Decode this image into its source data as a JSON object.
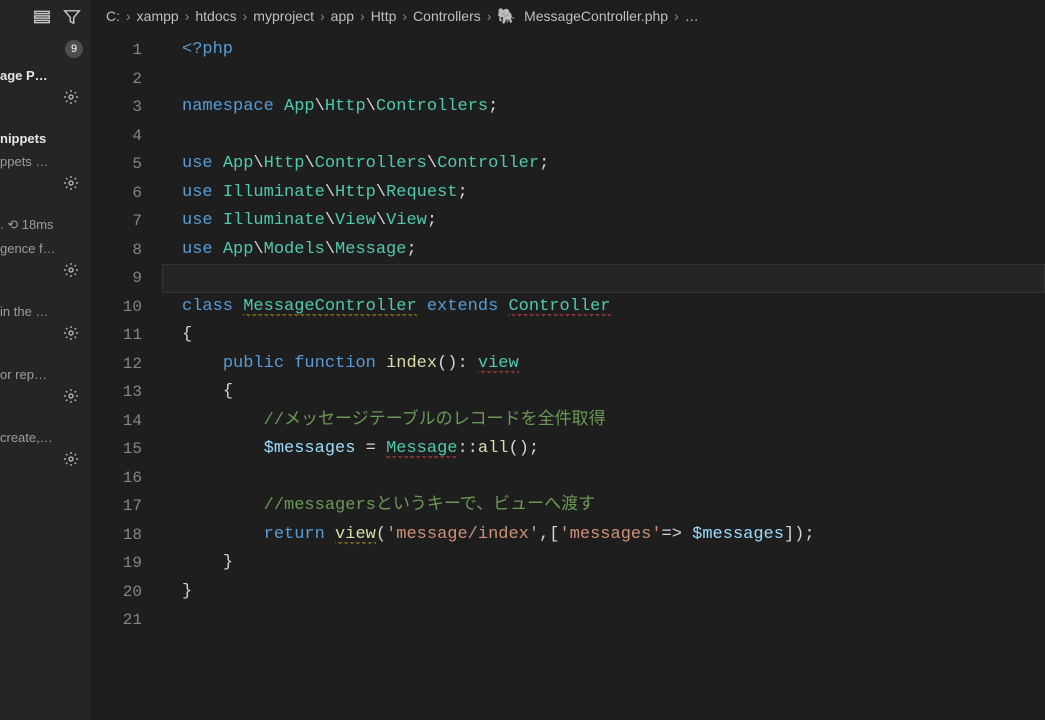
{
  "sidebar": {
    "badge": "9",
    "items": [
      {
        "title": "age P…",
        "sub": ""
      },
      {
        "title": "nippets",
        "sub": "ppets …"
      },
      {
        "title": "",
        "sub": "",
        "extra": ". ⟲ 18ms",
        "extra2": "gence f…"
      },
      {
        "title": "",
        "sub": "in the …"
      },
      {
        "title": "",
        "sub": "or rep…"
      },
      {
        "title": "",
        "sub": "create,…"
      }
    ]
  },
  "breadcrumb": {
    "parts": [
      "C:",
      "xampp",
      "htdocs",
      "myproject",
      "app",
      "Http",
      "Controllers",
      "MessageController.php",
      "…"
    ]
  },
  "code": {
    "lines": [
      [
        {
          "c": "tok-tag",
          "t": "<?php"
        }
      ],
      [],
      [
        {
          "c": "tok-kw",
          "t": "namespace"
        },
        {
          "t": " "
        },
        {
          "c": "tok-ns",
          "t": "App"
        },
        {
          "c": "tok-punc",
          "t": "\\"
        },
        {
          "c": "tok-ns",
          "t": "Http"
        },
        {
          "c": "tok-punc",
          "t": "\\"
        },
        {
          "c": "tok-ns",
          "t": "Controllers"
        },
        {
          "c": "tok-punc",
          "t": ";"
        }
      ],
      [],
      [
        {
          "c": "tok-kw",
          "t": "use"
        },
        {
          "t": " "
        },
        {
          "c": "tok-ns",
          "t": "App"
        },
        {
          "c": "tok-punc",
          "t": "\\"
        },
        {
          "c": "tok-ns",
          "t": "Http"
        },
        {
          "c": "tok-punc",
          "t": "\\"
        },
        {
          "c": "tok-ns",
          "t": "Controllers"
        },
        {
          "c": "tok-punc",
          "t": "\\"
        },
        {
          "c": "tok-ns",
          "t": "Controller"
        },
        {
          "c": "tok-punc",
          "t": ";"
        }
      ],
      [
        {
          "c": "tok-kw",
          "t": "use"
        },
        {
          "t": " "
        },
        {
          "c": "tok-ns",
          "t": "Illuminate"
        },
        {
          "c": "tok-punc",
          "t": "\\"
        },
        {
          "c": "tok-ns",
          "t": "Http"
        },
        {
          "c": "tok-punc",
          "t": "\\"
        },
        {
          "c": "tok-ns",
          "t": "Request"
        },
        {
          "c": "tok-punc",
          "t": ";"
        }
      ],
      [
        {
          "c": "tok-kw",
          "t": "use"
        },
        {
          "t": " "
        },
        {
          "c": "tok-ns",
          "t": "Illuminate"
        },
        {
          "c": "tok-punc",
          "t": "\\"
        },
        {
          "c": "tok-ns",
          "t": "View"
        },
        {
          "c": "tok-punc",
          "t": "\\"
        },
        {
          "c": "tok-ns",
          "t": "View"
        },
        {
          "c": "tok-punc",
          "t": ";"
        }
      ],
      [
        {
          "c": "tok-kw",
          "t": "use"
        },
        {
          "t": " "
        },
        {
          "c": "tok-ns",
          "t": "App"
        },
        {
          "c": "tok-punc",
          "t": "\\"
        },
        {
          "c": "tok-ns",
          "t": "Models"
        },
        {
          "c": "tok-punc",
          "t": "\\"
        },
        {
          "c": "tok-ns",
          "t": "Message"
        },
        {
          "c": "tok-punc",
          "t": ";"
        }
      ],
      [],
      [
        {
          "c": "tok-kw",
          "t": "class"
        },
        {
          "t": " "
        },
        {
          "c": "tok-class",
          "t": "MessageController",
          "u": "warn"
        },
        {
          "t": " "
        },
        {
          "c": "tok-kw",
          "t": "extends"
        },
        {
          "t": " "
        },
        {
          "c": "tok-class",
          "t": "Controller",
          "u": "err"
        }
      ],
      [
        {
          "c": "tok-punc",
          "t": "{"
        }
      ],
      [
        {
          "t": "    "
        },
        {
          "c": "tok-kw",
          "t": "public"
        },
        {
          "t": " "
        },
        {
          "c": "tok-kw",
          "t": "function"
        },
        {
          "t": " "
        },
        {
          "c": "tok-fn",
          "t": "index"
        },
        {
          "c": "tok-punc",
          "t": "()"
        },
        {
          "c": "tok-punc",
          "t": ": "
        },
        {
          "c": "tok-class",
          "t": "view",
          "u": "err"
        }
      ],
      [
        {
          "t": "    "
        },
        {
          "c": "tok-punc",
          "t": "{"
        }
      ],
      [
        {
          "t": "        "
        },
        {
          "c": "tok-com",
          "t": "//メッセージテーブルのレコードを全件取得"
        }
      ],
      [
        {
          "t": "        "
        },
        {
          "c": "tok-var",
          "t": "$messages"
        },
        {
          "t": " "
        },
        {
          "c": "tok-punc",
          "t": "= "
        },
        {
          "c": "tok-class",
          "t": "Message",
          "u": "err"
        },
        {
          "c": "tok-punc",
          "t": "::"
        },
        {
          "c": "tok-fn",
          "t": "all"
        },
        {
          "c": "tok-punc",
          "t": "();"
        }
      ],
      [],
      [
        {
          "t": "        "
        },
        {
          "c": "tok-com",
          "t": "//messagersというキーで、ビューへ渡す"
        }
      ],
      [
        {
          "t": "        "
        },
        {
          "c": "tok-kw",
          "t": "return"
        },
        {
          "t": " "
        },
        {
          "c": "tok-fn",
          "t": "view",
          "u": "warn"
        },
        {
          "c": "tok-punc",
          "t": "("
        },
        {
          "c": "tok-str",
          "t": "'message/index'"
        },
        {
          "c": "tok-punc",
          "t": ",["
        },
        {
          "c": "tok-str",
          "t": "'messages'"
        },
        {
          "c": "tok-punc",
          "t": "=> "
        },
        {
          "c": "tok-var",
          "t": "$messages"
        },
        {
          "c": "tok-punc",
          "t": "]);"
        }
      ],
      [
        {
          "t": "    "
        },
        {
          "c": "tok-punc",
          "t": "}"
        }
      ],
      [
        {
          "c": "tok-punc",
          "t": "}"
        }
      ],
      []
    ],
    "current_line": 9
  }
}
